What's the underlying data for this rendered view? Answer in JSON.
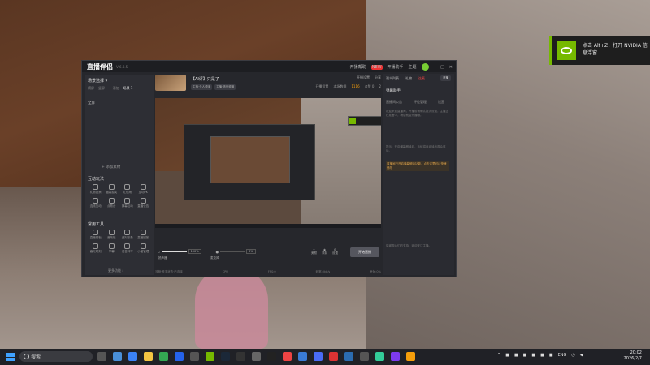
{
  "app": {
    "logo": "直播伴侣",
    "version": "V 6.8.5",
    "titlebar": {
      "new_badge": "NEW",
      "live_btn": "开播帮助",
      "messages": "开播助手",
      "skin": "主题"
    },
    "scene": {
      "title": "场景选择 ▾",
      "tabs": [
        "横屏",
        "竖屏",
        "+ 添加",
        "场景 1"
      ],
      "source_item": "全屏",
      "add_source": "+ 添加素材"
    },
    "interactive": {
      "title": "互动玩法",
      "items": [
        "礼物投票",
        "福袋抽奖",
        "红包雨",
        "互动PK",
        "连线互动",
        "点歌台",
        "弹幕互动",
        "直播公告"
      ]
    },
    "tools": {
      "title": "常用工具",
      "items": [
        "直播看板",
        "音效板",
        "虚拟形象",
        "直播回放",
        "高光时刻",
        "字幕",
        "语音转写",
        "小窗管理"
      ],
      "more": "更多功能 ›"
    },
    "room": {
      "title": "【AI评】只是了",
      "tags": [
        "主播·个人频道",
        "主播·精品频道"
      ],
      "links": [
        "开播设置",
        "分享"
      ],
      "stats": [
        "开播设置",
        "本场数据",
        "1116",
        "点赞 0",
        "2"
      ]
    },
    "bottom": {
      "volume_value": "100%",
      "mic_value": "0%",
      "volume_label": "扬声器",
      "mic_label": "麦克风",
      "actions": [
        "美颜",
        "录制",
        "设置"
      ],
      "go_live": "开始直播"
    },
    "statusbar": [
      "流畅·推流状态·已连接",
      "CPU",
      "FPS:0",
      "码率:0kb/s",
      "丢帧:0%"
    ],
    "right": {
      "tabs": [
        "观众列表",
        "礼物",
        "连麦",
        "开播"
      ],
      "head": "弹幕助手",
      "sub": [
        "直播间公告",
        "评论管理",
        "设置"
      ],
      "text1": "欢迎来到直播间，开播前请确认推流设置，主播正在准备中，稍后就会开播哦。",
      "text2": "提示：开启弹幕朗读后，系统将自动读出观众评论。",
      "highlight": "直播间已开启弹幕朗读功能，点击这里可以快速修改",
      "text3": "感谢观众们的支持，欢迎关注主播。"
    }
  },
  "toast": {
    "text": "点击 Alt+Z，打开 NVIDIA 信息浮窗"
  },
  "taskbar": {
    "search_placeholder": "搜索",
    "tray_lang": "ENG",
    "time": "20:02",
    "date": "2026/2/7"
  },
  "colors": {
    "nvidia": "#76b900",
    "accent_orange": "#f59e0b",
    "taskbar": "#202126"
  }
}
